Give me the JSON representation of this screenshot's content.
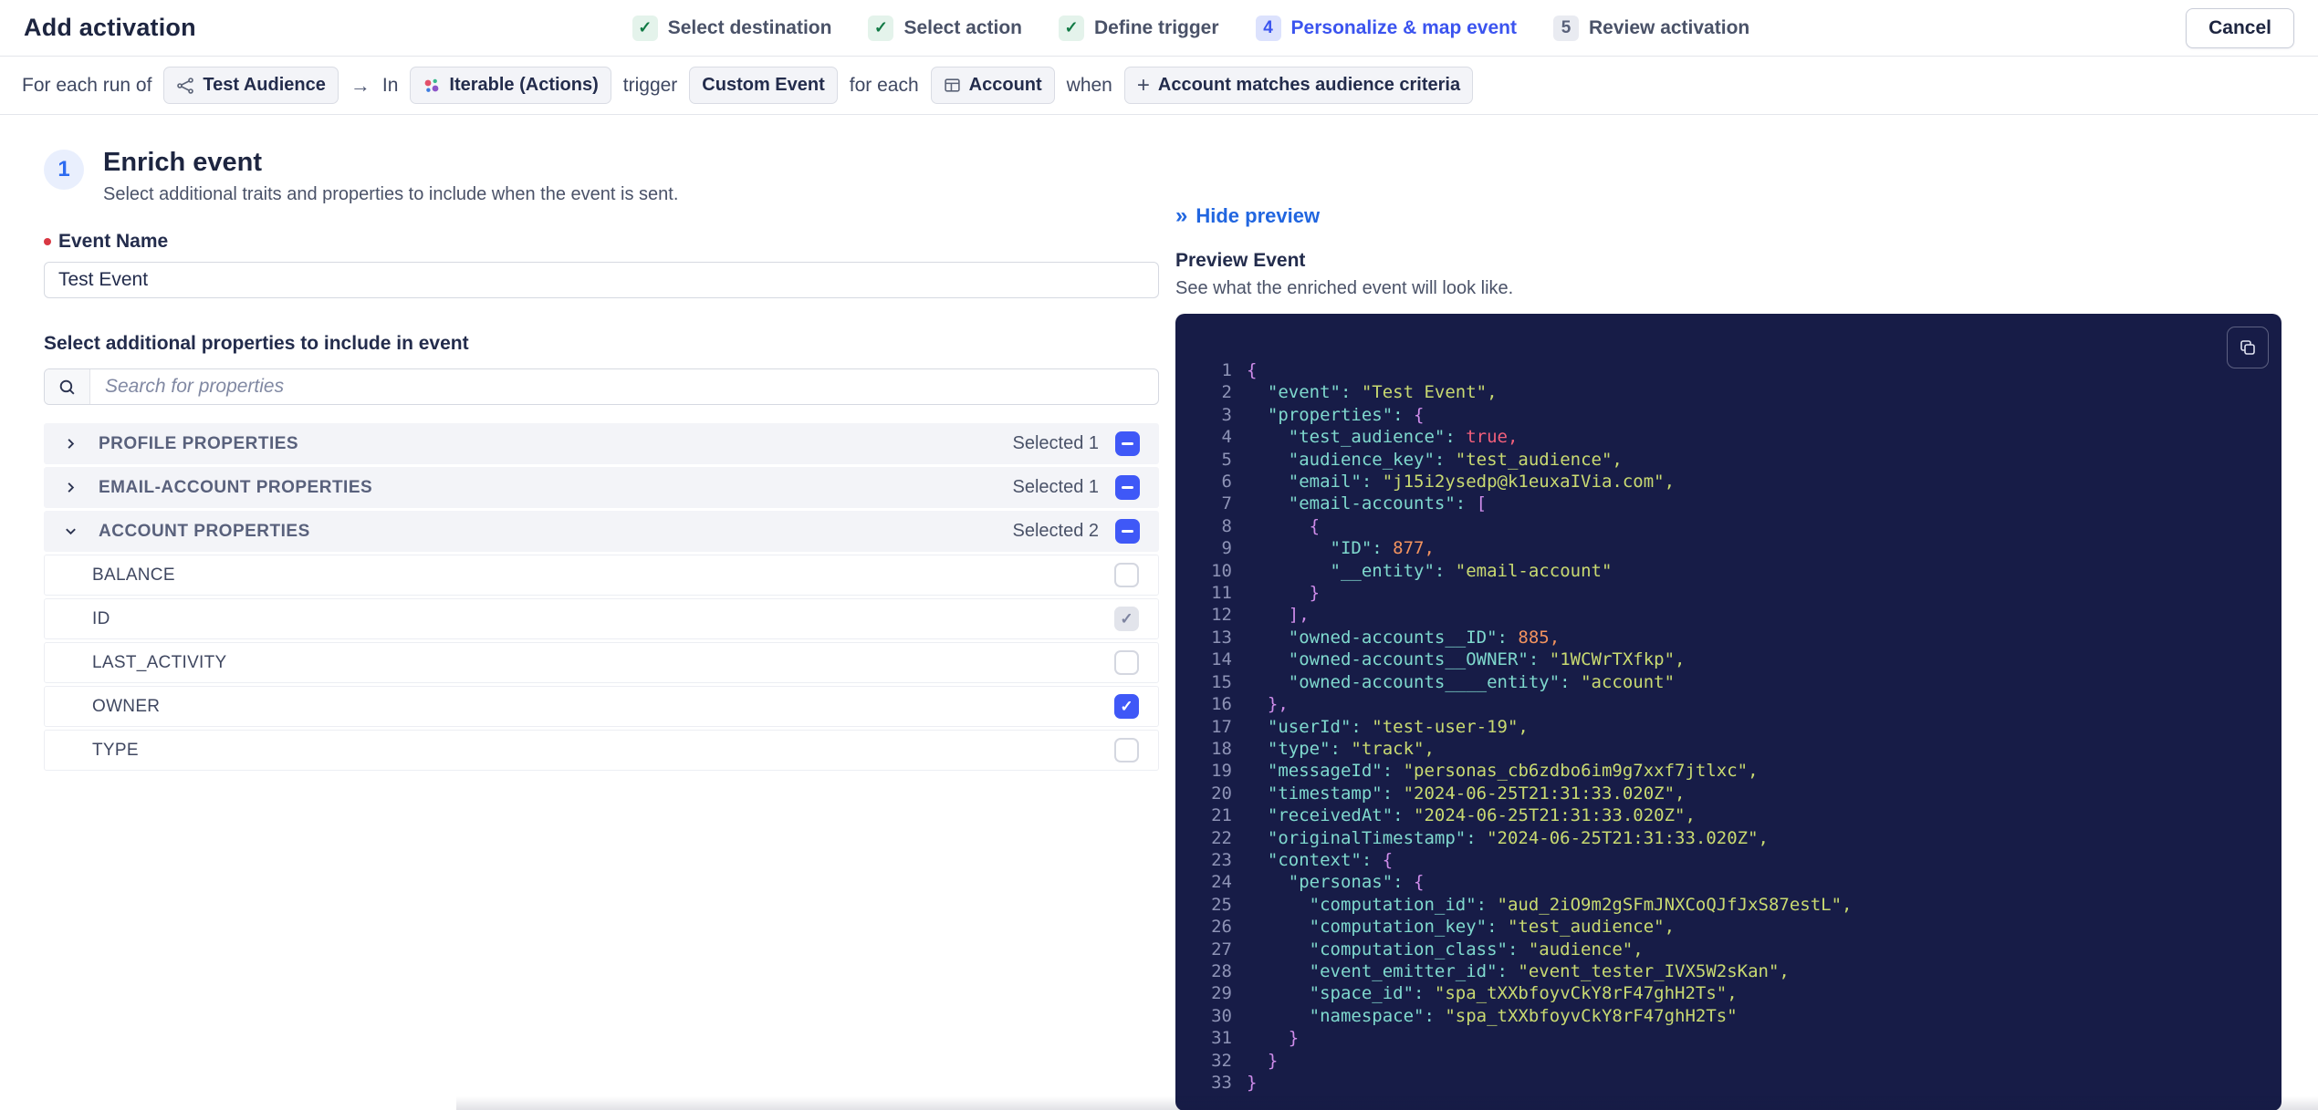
{
  "header": {
    "title": "Add activation",
    "cancel_label": "Cancel",
    "steps": [
      {
        "label": "Select destination",
        "state": "done"
      },
      {
        "label": "Select action",
        "state": "done"
      },
      {
        "label": "Define trigger",
        "state": "done"
      },
      {
        "label": "Personalize & map event",
        "state": "current",
        "number": "4"
      },
      {
        "label": "Review activation",
        "state": "todo",
        "number": "5"
      }
    ]
  },
  "trigger_bar": {
    "prefix": "For each run of",
    "audience_badge": "Test Audience",
    "arrow": "→",
    "in_label": "In",
    "destination_badge": "Iterable (Actions)",
    "trigger_label": "trigger",
    "event_badge": "Custom Event",
    "for_each_label": "for each",
    "entity_badge": "Account",
    "when_label": "when",
    "criteria_badge": "Account matches audience criteria"
  },
  "enrich": {
    "step_number": "1",
    "title": "Enrich event",
    "subtitle": "Select additional traits and properties to include when the event is sent.",
    "event_name_label": "Event Name",
    "event_name_value": "Test Event",
    "properties_label": "Select additional properties to include in event",
    "search_placeholder": "Search for properties",
    "sections": [
      {
        "label": "PROFILE PROPERTIES",
        "selected": "Selected 1",
        "expanded": false
      },
      {
        "label": "EMAIL-ACCOUNT PROPERTIES",
        "selected": "Selected 1",
        "expanded": false
      },
      {
        "label": "ACCOUNT PROPERTIES",
        "selected": "Selected 2",
        "expanded": true
      }
    ],
    "account_items": [
      {
        "label": "BALANCE",
        "state": "unchecked"
      },
      {
        "label": "ID",
        "state": "checked-disabled"
      },
      {
        "label": "LAST_ACTIVITY",
        "state": "unchecked"
      },
      {
        "label": "OWNER",
        "state": "checked"
      },
      {
        "label": "TYPE",
        "state": "unchecked"
      }
    ]
  },
  "preview": {
    "hide_label": "Hide preview",
    "hide_chevrons": "»",
    "title": "Preview Event",
    "subtitle": "See what the enriched event will look like.",
    "code_lines": [
      {
        "i": 0,
        "t": [
          [
            "p",
            "{"
          ]
        ]
      },
      {
        "i": 2,
        "t": [
          [
            "k",
            "\"event\":"
          ],
          [
            "s",
            " \"Test Event\","
          ]
        ]
      },
      {
        "i": 2,
        "t": [
          [
            "k",
            "\"properties\":"
          ],
          [
            "p",
            " {"
          ]
        ]
      },
      {
        "i": 4,
        "t": [
          [
            "k",
            "\"test_audience\":"
          ],
          [
            "b",
            " true,"
          ]
        ]
      },
      {
        "i": 4,
        "t": [
          [
            "k",
            "\"audience_key\":"
          ],
          [
            "s",
            " \"test_audience\","
          ]
        ]
      },
      {
        "i": 4,
        "t": [
          [
            "k",
            "\"email\":"
          ],
          [
            "s",
            " \"j15i2ysedp@k1euxaIVia.com\","
          ]
        ]
      },
      {
        "i": 4,
        "t": [
          [
            "k",
            "\"email-accounts\":"
          ],
          [
            "p",
            " ["
          ]
        ]
      },
      {
        "i": 6,
        "t": [
          [
            "p",
            "{"
          ]
        ]
      },
      {
        "i": 8,
        "t": [
          [
            "k",
            "\"ID\":"
          ],
          [
            "n",
            " 877,"
          ]
        ]
      },
      {
        "i": 8,
        "t": [
          [
            "k",
            "\"__entity\":"
          ],
          [
            "s",
            " \"email-account\""
          ]
        ]
      },
      {
        "i": 6,
        "t": [
          [
            "p",
            "}"
          ]
        ]
      },
      {
        "i": 4,
        "t": [
          [
            "p",
            "],"
          ]
        ]
      },
      {
        "i": 4,
        "t": [
          [
            "k",
            "\"owned-accounts__ID\":"
          ],
          [
            "n",
            " 885,"
          ]
        ]
      },
      {
        "i": 4,
        "t": [
          [
            "k",
            "\"owned-accounts__OWNER\":"
          ],
          [
            "s",
            " \"1WCWrTXfkp\","
          ]
        ]
      },
      {
        "i": 4,
        "t": [
          [
            "k",
            "\"owned-accounts____entity\":"
          ],
          [
            "s",
            " \"account\""
          ]
        ]
      },
      {
        "i": 2,
        "t": [
          [
            "p",
            "},"
          ]
        ]
      },
      {
        "i": 2,
        "t": [
          [
            "k",
            "\"userId\":"
          ],
          [
            "s",
            " \"test-user-19\","
          ]
        ]
      },
      {
        "i": 2,
        "t": [
          [
            "k",
            "\"type\":"
          ],
          [
            "s",
            " \"track\","
          ]
        ]
      },
      {
        "i": 2,
        "t": [
          [
            "k",
            "\"messageId\":"
          ],
          [
            "s",
            " \"personas_cb6zdbo6im9g7xxf7jtlxc\","
          ]
        ]
      },
      {
        "i": 2,
        "t": [
          [
            "k",
            "\"timestamp\":"
          ],
          [
            "s",
            " \"2024-06-25T21:31:33.020Z\","
          ]
        ]
      },
      {
        "i": 2,
        "t": [
          [
            "k",
            "\"receivedAt\":"
          ],
          [
            "s",
            " \"2024-06-25T21:31:33.020Z\","
          ]
        ]
      },
      {
        "i": 2,
        "t": [
          [
            "k",
            "\"originalTimestamp\":"
          ],
          [
            "s",
            " \"2024-06-25T21:31:33.020Z\","
          ]
        ]
      },
      {
        "i": 2,
        "t": [
          [
            "k",
            "\"context\":"
          ],
          [
            "p",
            " {"
          ]
        ]
      },
      {
        "i": 4,
        "t": [
          [
            "k",
            "\"personas\":"
          ],
          [
            "p",
            " {"
          ]
        ]
      },
      {
        "i": 6,
        "t": [
          [
            "k",
            "\"computation_id\":"
          ],
          [
            "s",
            " \"aud_2iO9m2gSFmJNXCoQJfJxS87estL\","
          ]
        ]
      },
      {
        "i": 6,
        "t": [
          [
            "k",
            "\"computation_key\":"
          ],
          [
            "s",
            " \"test_audience\","
          ]
        ]
      },
      {
        "i": 6,
        "t": [
          [
            "k",
            "\"computation_class\":"
          ],
          [
            "s",
            " \"audience\","
          ]
        ]
      },
      {
        "i": 6,
        "t": [
          [
            "k",
            "\"event_emitter_id\":"
          ],
          [
            "s",
            " \"event_tester_IVX5W2sKan\","
          ]
        ]
      },
      {
        "i": 6,
        "t": [
          [
            "k",
            "\"space_id\":"
          ],
          [
            "s",
            " \"spa_tXXbfoyvCkY8rF47ghH2Ts\","
          ]
        ]
      },
      {
        "i": 6,
        "t": [
          [
            "k",
            "\"namespace\":"
          ],
          [
            "s",
            " \"spa_tXXbfoyvCkY8rF47ghH2Ts\""
          ]
        ]
      },
      {
        "i": 4,
        "t": [
          [
            "p",
            "}"
          ]
        ]
      },
      {
        "i": 2,
        "t": [
          [
            "p",
            "}"
          ]
        ]
      },
      {
        "i": 0,
        "t": [
          [
            "p",
            "}"
          ]
        ]
      }
    ]
  },
  "colors": {
    "accent_blue": "#3b54ef",
    "link_blue": "#2166e0",
    "success_green": "#117a45",
    "checkbox_blue": "#3f58f7",
    "required_red": "#d93843",
    "code_panel_bg": "#171c47",
    "code_key": "#7fd9ce",
    "code_string": "#c9da71",
    "code_number": "#f3935f",
    "code_boolean": "#f25f7b",
    "code_punct": "#cf8cea"
  }
}
